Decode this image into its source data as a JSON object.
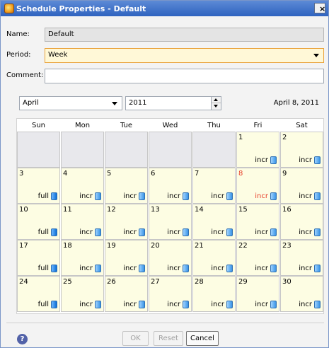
{
  "window": {
    "title": "Schedule Properties - Default",
    "close_label": "×"
  },
  "form": {
    "name_label": "Name:",
    "name_value": "Default",
    "period_label": "Period:",
    "period_value": "Week",
    "comment_label": "Comment:",
    "comment_value": ""
  },
  "calendar": {
    "month": "April",
    "year": "2011",
    "current_date": "April 8, 2011",
    "days": [
      "Sun",
      "Mon",
      "Tue",
      "Wed",
      "Thu",
      "Fri",
      "Sat"
    ],
    "weeks": [
      [
        {
          "day": "",
          "type": ""
        },
        {
          "day": "",
          "type": ""
        },
        {
          "day": "",
          "type": ""
        },
        {
          "day": "",
          "type": ""
        },
        {
          "day": "",
          "type": ""
        },
        {
          "day": "1",
          "type": "incr"
        },
        {
          "day": "2",
          "type": "incr"
        }
      ],
      [
        {
          "day": "3",
          "type": "full"
        },
        {
          "day": "4",
          "type": "incr"
        },
        {
          "day": "5",
          "type": "incr"
        },
        {
          "day": "6",
          "type": "incr"
        },
        {
          "day": "7",
          "type": "incr"
        },
        {
          "day": "8",
          "type": "incr",
          "today": true
        },
        {
          "day": "9",
          "type": "incr"
        }
      ],
      [
        {
          "day": "10",
          "type": "full"
        },
        {
          "day": "11",
          "type": "incr"
        },
        {
          "day": "12",
          "type": "incr"
        },
        {
          "day": "13",
          "type": "incr"
        },
        {
          "day": "14",
          "type": "incr"
        },
        {
          "day": "15",
          "type": "incr"
        },
        {
          "day": "16",
          "type": "incr"
        }
      ],
      [
        {
          "day": "17",
          "type": "full"
        },
        {
          "day": "18",
          "type": "incr"
        },
        {
          "day": "19",
          "type": "incr"
        },
        {
          "day": "20",
          "type": "incr"
        },
        {
          "day": "21",
          "type": "incr"
        },
        {
          "day": "22",
          "type": "incr"
        },
        {
          "day": "23",
          "type": "incr"
        }
      ],
      [
        {
          "day": "24",
          "type": "full"
        },
        {
          "day": "25",
          "type": "incr"
        },
        {
          "day": "26",
          "type": "incr"
        },
        {
          "day": "27",
          "type": "incr"
        },
        {
          "day": "28",
          "type": "incr"
        },
        {
          "day": "29",
          "type": "incr"
        },
        {
          "day": "30",
          "type": "incr"
        }
      ]
    ]
  },
  "footer": {
    "help_label": "?",
    "ok_label": "OK",
    "reset_label": "Reset",
    "cancel_label": "Cancel"
  },
  "colors": {
    "titlebar": "#2f63c0",
    "period_highlight": "#e9a23a",
    "cell_background": "#fdfde3",
    "empty_cell": "#e8e8ec",
    "today": "#e8412c"
  },
  "icons": {
    "title": "schedule-icon",
    "backup": "database-icon",
    "help": "help-icon"
  }
}
